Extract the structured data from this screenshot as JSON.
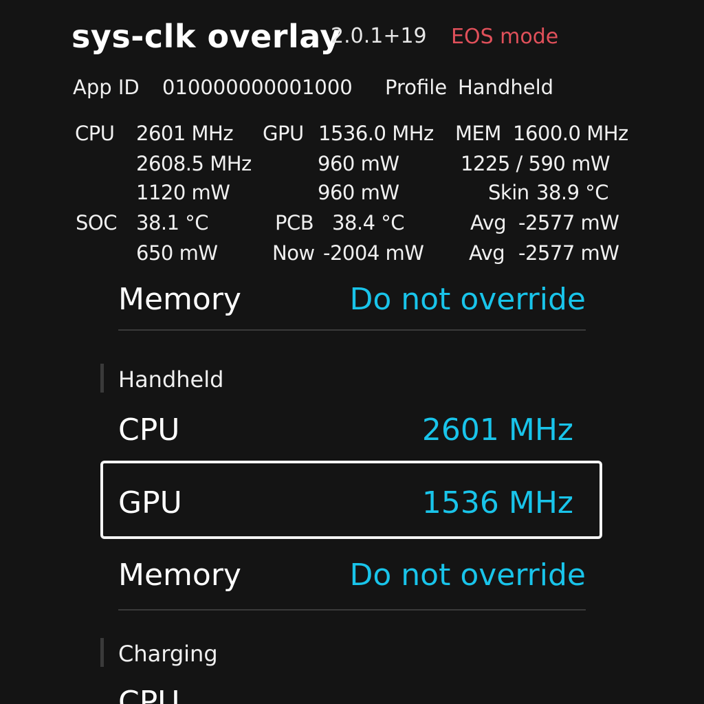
{
  "header": {
    "title": "sys-clk overlay",
    "version": "2.0.1+19",
    "mode": "EOS mode"
  },
  "info": {
    "app_id_label": "App ID",
    "app_id_value": "010000000001000",
    "profile_label": "Profile",
    "profile_value": "Handheld"
  },
  "stats": {
    "cpu_label": "CPU",
    "cpu_freq": "2601 MHz",
    "cpu_real": "2608.5 MHz",
    "cpu_power": "1120 mW",
    "gpu_label": "GPU",
    "gpu_freq": "1536.0 MHz",
    "gpu_power_1": "960 mW",
    "gpu_power_2": "960 mW",
    "mem_label": "MEM",
    "mem_freq": "1600.0 MHz",
    "mem_power": "1225 /  590 mW",
    "skin_label": "Skin",
    "skin_temp": "38.9 °C",
    "soc_label": "SOC",
    "soc_temp": "38.1 °C",
    "soc_power": "650 mW",
    "pcb_label": "PCB",
    "pcb_temp": "38.4 °C",
    "now_label": "Now",
    "now_power": "-2004 mW",
    "avg_label_1": "Avg",
    "avg_power_1": "-2577 mW",
    "avg_label_2": "Avg",
    "avg_power_2": "-2577 mW"
  },
  "menu": {
    "top_memory": {
      "label": "Memory",
      "value": "Do not override"
    },
    "handheld": {
      "title": "Handheld",
      "cpu": {
        "label": "CPU",
        "value": "2601 MHz"
      },
      "gpu": {
        "label": "GPU",
        "value": "1536 MHz"
      },
      "memory": {
        "label": "Memory",
        "value": "Do not override"
      }
    },
    "charging": {
      "title": "Charging",
      "cpu": {
        "label": "CPU"
      }
    }
  }
}
